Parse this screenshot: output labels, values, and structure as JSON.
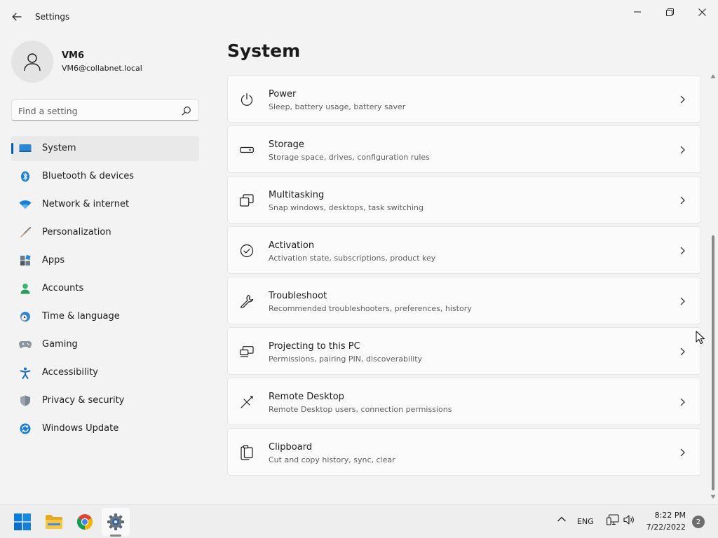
{
  "window": {
    "title": "Settings",
    "controls": {
      "minimize": "minimize-icon",
      "maximize": "restore-icon",
      "close": "close-icon"
    }
  },
  "profile": {
    "name": "VM6",
    "email": "VM6@collabnet.local"
  },
  "search": {
    "placeholder": "Find a setting"
  },
  "sidebar": {
    "active": "System",
    "items": [
      {
        "label": "System",
        "icon": "monitor-icon"
      },
      {
        "label": "Bluetooth & devices",
        "icon": "bluetooth-icon"
      },
      {
        "label": "Network & internet",
        "icon": "wifi-icon"
      },
      {
        "label": "Personalization",
        "icon": "brush-icon"
      },
      {
        "label": "Apps",
        "icon": "apps-icon"
      },
      {
        "label": "Accounts",
        "icon": "person-icon"
      },
      {
        "label": "Time & language",
        "icon": "clock-globe-icon"
      },
      {
        "label": "Gaming",
        "icon": "gamepad-icon"
      },
      {
        "label": "Accessibility",
        "icon": "accessibility-icon"
      },
      {
        "label": "Privacy & security",
        "icon": "shield-icon"
      },
      {
        "label": "Windows Update",
        "icon": "sync-icon"
      }
    ]
  },
  "main": {
    "title": "System",
    "cards": [
      {
        "title": "Power",
        "subtitle": "Sleep, battery usage, battery saver",
        "icon": "power-icon"
      },
      {
        "title": "Storage",
        "subtitle": "Storage space, drives, configuration rules",
        "icon": "drive-icon"
      },
      {
        "title": "Multitasking",
        "subtitle": "Snap windows, desktops, task switching",
        "icon": "multitask-icon"
      },
      {
        "title": "Activation",
        "subtitle": "Activation state, subscriptions, product key",
        "icon": "check-circle-icon"
      },
      {
        "title": "Troubleshoot",
        "subtitle": "Recommended troubleshooters, preferences, history",
        "icon": "wrench-icon"
      },
      {
        "title": "Projecting to this PC",
        "subtitle": "Permissions, pairing PIN, discoverability",
        "icon": "projector-icon"
      },
      {
        "title": "Remote Desktop",
        "subtitle": "Remote Desktop users, connection permissions",
        "icon": "remote-desktop-icon"
      },
      {
        "title": "Clipboard",
        "subtitle": "Cut and copy history, sync, clear",
        "icon": "clipboard-icon"
      }
    ]
  },
  "taskbar": {
    "apps": [
      {
        "name": "start",
        "icon": "windows-logo-icon"
      },
      {
        "name": "file-explorer",
        "icon": "folder-icon"
      },
      {
        "name": "chrome",
        "icon": "chrome-icon"
      },
      {
        "name": "settings",
        "icon": "gear-icon"
      }
    ],
    "tray": {
      "language": "ENG",
      "time": "8:22 PM",
      "date": "7/22/2022",
      "notifications": "2"
    }
  },
  "colors": {
    "accent": "#005fb8",
    "background": "#f3f3f3",
    "card": "#fbfbfb"
  }
}
